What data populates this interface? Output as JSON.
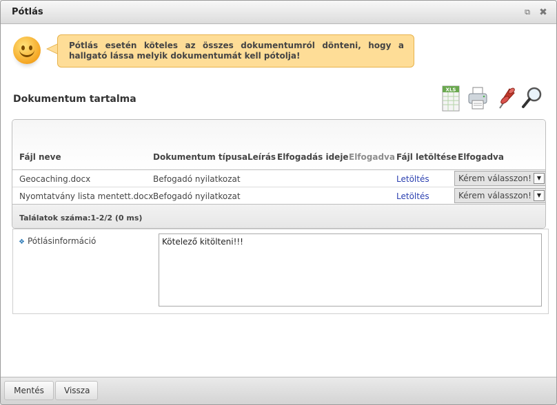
{
  "window": {
    "title": "Pótlás"
  },
  "notice": {
    "text": "Pótlás esetén köteles az összes dokumentumról dönteni, hogy a hallgató lássa melyik dokumentumát kell pótolja!"
  },
  "section": {
    "title": "Dokumentum tartalma"
  },
  "toolbar": {
    "xls_label": "XLS",
    "icons": [
      "excel-export-icon",
      "print-icon",
      "pin-icon",
      "search-icon"
    ]
  },
  "grid": {
    "columns": [
      "Fájl neve",
      "Dokumentum típusa",
      "Leírás",
      "Elfogadás ideje",
      "Elfogadva",
      "Fájl letöltése",
      "Elfogadva"
    ],
    "rows": [
      {
        "file": "Geocaching.docx",
        "type": "Befogadó nyilatkozat",
        "desc": "",
        "date": "",
        "accepted": "",
        "download": "Letöltés",
        "select": "Kérem válasszon!"
      },
      {
        "file": "Nyomtatvány lista mentett.docx",
        "type": "Befogadó nyilatkozat",
        "desc": "",
        "date": "",
        "accepted": "",
        "download": "Letöltés",
        "select": "Kérem válasszon!"
      }
    ],
    "footer": "Találatok száma:1-2/2 (0 ms)"
  },
  "info": {
    "label": "Pótlásinformáció",
    "value": "Kötelező kitölteni!!!"
  },
  "buttons": {
    "save": "Mentés",
    "back": "Vissza"
  }
}
